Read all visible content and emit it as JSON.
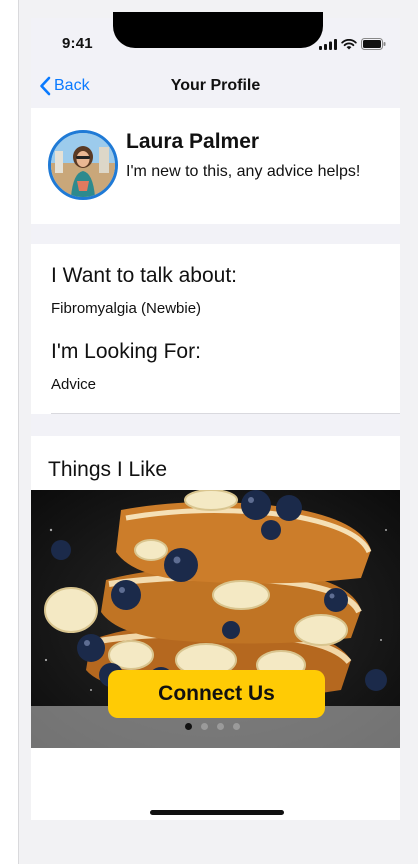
{
  "status": {
    "time": "9:41"
  },
  "nav": {
    "back_label": "Back",
    "title": "Your Profile"
  },
  "profile": {
    "name": "Laura Palmer",
    "bio": "I'm new to this, any advice helps!"
  },
  "interests": {
    "talk_heading": "I Want to talk about:",
    "talk_value": "Fibromyalgia (Newbie)",
    "looking_heading": "I'm Looking For:",
    "looking_value": "Advice"
  },
  "likes": {
    "title": "Things I Like",
    "photo_icon": "french-toast-photo",
    "carousel_pages": 4,
    "carousel_active": 1
  },
  "actions": {
    "connect_label": "Connect Us"
  },
  "colors": {
    "accent": "#0a7aff",
    "cta": "#ffcb05",
    "avatar_ring": "#1f7ad6"
  }
}
